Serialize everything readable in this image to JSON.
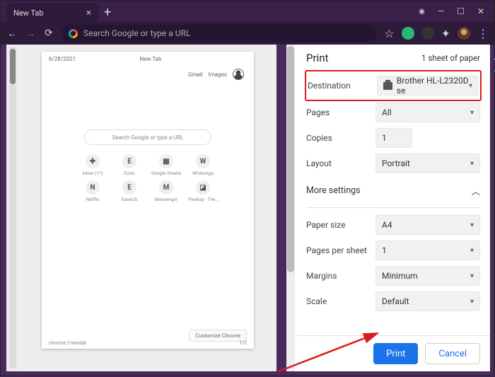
{
  "titlebar": {
    "tab_title": "New Tab",
    "close_glyph": "×",
    "new_tab_glyph": "+",
    "win_min": "—",
    "win_max": "☐",
    "win_close": "✕",
    "rec_glyph": "◉"
  },
  "toolbar": {
    "back": "←",
    "forward": "→",
    "reload": "⟳",
    "omnibox_placeholder": "Search Google or type a URL",
    "star": "☆",
    "ext_puzzle": "✦",
    "menu": "⋮"
  },
  "preview": {
    "date": "6/28/2021",
    "page_title": "New Tab",
    "links_gmail": "Gmail",
    "links_images": "Images",
    "search_placeholder": "Search Google or type a URL",
    "shortcuts": [
      {
        "icon": "✚",
        "label": "Inbox (17)"
      },
      {
        "icon": "E",
        "label": "Ezoic"
      },
      {
        "icon": "▦",
        "label": "Google Sheets"
      },
      {
        "icon": "W",
        "label": "WhatsApp"
      },
      {
        "icon": "N",
        "label": "Netflix"
      },
      {
        "icon": "E",
        "label": "EaseUS"
      },
      {
        "icon": "M",
        "label": "Messenger"
      },
      {
        "icon": "◪",
        "label": "Pixabay · The..."
      }
    ],
    "customize": "Customize Chrome",
    "footer_url": "chrome://newtab",
    "footer_page": "1/2"
  },
  "print": {
    "title": "Print",
    "sheets": "1 sheet of paper",
    "labels": {
      "destination": "Destination",
      "pages": "Pages",
      "copies": "Copies",
      "layout": "Layout",
      "more": "More settings",
      "paper": "Paper size",
      "pps": "Pages per sheet",
      "margins": "Margins",
      "scale": "Scale"
    },
    "values": {
      "destination": "Brother HL-L2320D se",
      "pages": "All",
      "copies": "1",
      "layout": "Portrait",
      "paper": "A4",
      "pps": "1",
      "margins": "Minimum",
      "scale": "Default"
    },
    "more_caret": "︿",
    "btn_print": "Print",
    "btn_cancel": "Cancel"
  }
}
